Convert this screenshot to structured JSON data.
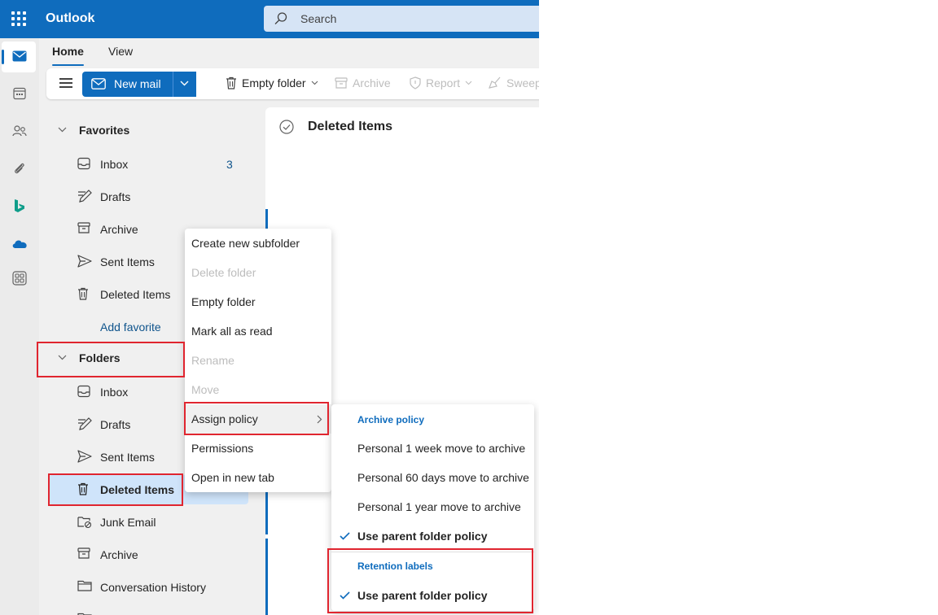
{
  "app": {
    "title": "Outlook",
    "accent": "#0f6cbd"
  },
  "search": {
    "placeholder": "Search"
  },
  "rail": [
    {
      "name": "mail-icon",
      "active": true
    },
    {
      "name": "calendar-icon"
    },
    {
      "name": "people-icon"
    },
    {
      "name": "paperclip-icon"
    },
    {
      "name": "bing-icon"
    },
    {
      "name": "onedrive-icon"
    },
    {
      "name": "apps-icon"
    }
  ],
  "ribbon": {
    "tabs": [
      {
        "label": "Home"
      },
      {
        "label": "View"
      }
    ],
    "new_mail": "New mail",
    "empty_folder": "Empty folder",
    "archive": "Archive",
    "report": "Report",
    "sweep": "Sweep"
  },
  "favorites": {
    "header": "Favorites",
    "items": [
      {
        "label": "Inbox",
        "icon": "inbox-icon",
        "count": "3"
      },
      {
        "label": "Drafts",
        "icon": "drafts-icon"
      },
      {
        "label": "Archive",
        "icon": "archive-icon"
      },
      {
        "label": "Sent Items",
        "icon": "sent-icon"
      },
      {
        "label": "Deleted Items",
        "icon": "trash-icon"
      }
    ],
    "add_favorite": "Add favorite"
  },
  "folders": {
    "header": "Folders",
    "items": [
      {
        "label": "Inbox",
        "icon": "inbox-icon"
      },
      {
        "label": "Drafts",
        "icon": "drafts-icon"
      },
      {
        "label": "Sent Items",
        "icon": "sent-icon"
      },
      {
        "label": "Deleted Items",
        "icon": "trash-icon",
        "selected": true
      },
      {
        "label": "Junk Email",
        "icon": "junk-icon"
      },
      {
        "label": "Archive",
        "icon": "archive-icon"
      },
      {
        "label": "Conversation History",
        "icon": "folder-icon"
      }
    ]
  },
  "message_list": {
    "title": "Deleted Items"
  },
  "context_menu": {
    "items": [
      {
        "label": "Create new subfolder",
        "disabled": false
      },
      {
        "label": "Delete folder",
        "disabled": true
      },
      {
        "label": "Empty folder",
        "disabled": false
      },
      {
        "label": "Mark all as read",
        "disabled": false
      },
      {
        "label": "Rename",
        "disabled": true
      },
      {
        "label": "Move",
        "disabled": true
      },
      {
        "label": "Assign policy",
        "disabled": false,
        "submenu": true
      },
      {
        "label": "Permissions",
        "disabled": false
      },
      {
        "label": "Open in new tab",
        "disabled": false
      }
    ]
  },
  "policy_submenu": {
    "archive_header": "Archive policy",
    "archive_items": [
      {
        "label": "Personal 1 week move to archive",
        "checked": false
      },
      {
        "label": "Personal 60 days move to archive",
        "checked": false
      },
      {
        "label": "Personal 1 year move to archive",
        "checked": false
      },
      {
        "label": "Use parent folder policy",
        "checked": true
      }
    ],
    "retention_header": "Retention labels",
    "retention_items": [
      {
        "label": "Use parent folder policy",
        "checked": true
      }
    ]
  },
  "highlight_color": "#e0252f"
}
